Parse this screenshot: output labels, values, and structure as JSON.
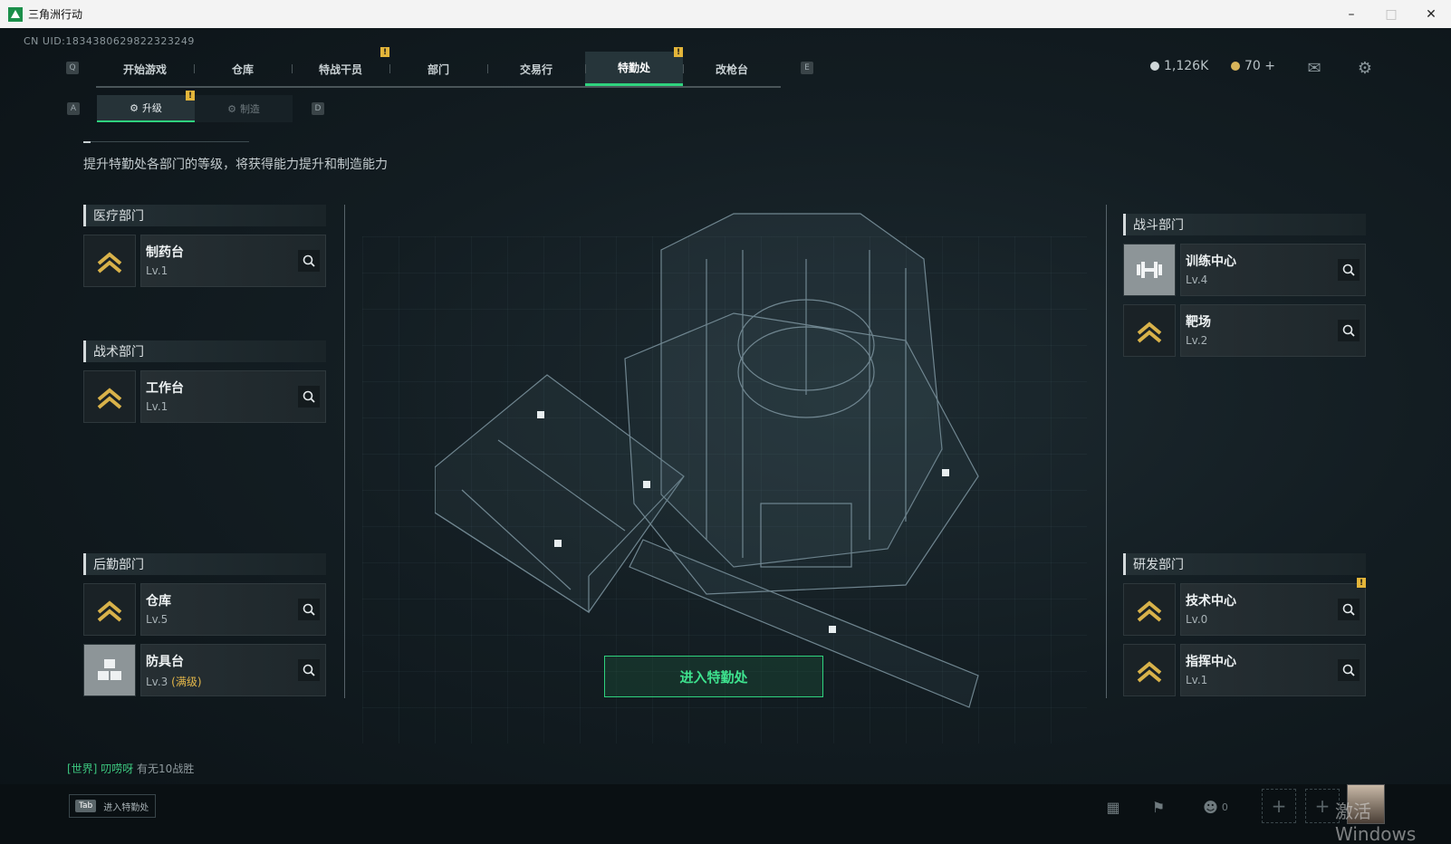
{
  "window": {
    "title": "三角洲行动"
  },
  "uid": "CN UID:1834380629822323249",
  "nav": {
    "left_key": "Q",
    "right_key": "E",
    "tabs": [
      {
        "label": "开始游戏"
      },
      {
        "label": "仓库"
      },
      {
        "label": "特战干员",
        "warn": true
      },
      {
        "label": "部门"
      },
      {
        "label": "交易行"
      },
      {
        "label": "特勤处",
        "active": true,
        "warn": true
      },
      {
        "label": "改枪台"
      }
    ]
  },
  "currency": {
    "primary": "1,126K",
    "secondary": "70 +"
  },
  "subtabs": {
    "left_key": "A",
    "right_key": "D",
    "items": [
      {
        "label": "升级",
        "active": true,
        "warn": true
      },
      {
        "label": "制造"
      }
    ]
  },
  "subtitle": "提升特勤处各部门的等级，将获得能力提升和制造能力",
  "departments": {
    "medical": {
      "title": "医疗部门",
      "facilities": [
        {
          "name": "制药台",
          "level": "Lv.1"
        }
      ]
    },
    "tactical": {
      "title": "战术部门",
      "facilities": [
        {
          "name": "工作台",
          "level": "Lv.1"
        }
      ]
    },
    "logistics": {
      "title": "后勤部门",
      "facilities": [
        {
          "name": "仓库",
          "level": "Lv.5"
        },
        {
          "name": "防具台",
          "level": "Lv.3",
          "note": "(满级)"
        }
      ]
    },
    "combat": {
      "title": "战斗部门",
      "facilities": [
        {
          "name": "训练中心",
          "level": "Lv.4"
        },
        {
          "name": "靶场",
          "level": "Lv.2"
        }
      ]
    },
    "research": {
      "title": "研发部门",
      "facilities": [
        {
          "name": "技术中心",
          "level": "Lv.0",
          "warn": true
        },
        {
          "name": "指挥中心",
          "level": "Lv.1"
        }
      ]
    }
  },
  "enter_button": "进入特勤处",
  "chat": {
    "channel": "[世界]",
    "user": "叨唠呀",
    "message": "有无10战胜"
  },
  "bottom": {
    "tab_key": "Tab",
    "tab_label": "进入特勤处",
    "friends_count": "0"
  },
  "warn_mark": "!",
  "plus": "+",
  "taskbar": {
    "watermark": "激活 Windows"
  },
  "colors": {
    "accent": "#2fd27e",
    "warning": "#e3b53a",
    "max_level": "#e5b84a"
  }
}
